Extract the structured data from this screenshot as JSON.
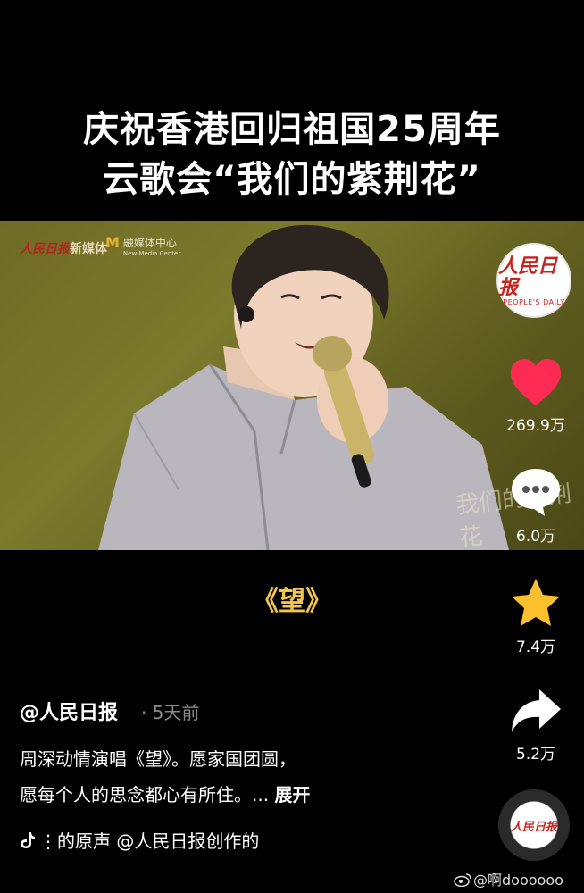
{
  "header": {
    "line1": "庆祝香港回归祖国25周年",
    "line2": "云歌会“我们的紫荆花”"
  },
  "video": {
    "watermark_left_red": "人民日报",
    "watermark_left_text": "新媒体",
    "watermark_right": "融媒体中心",
    "watermark_right_sub": "New Media Center",
    "calligraphy": "我们的紫荆花"
  },
  "song_title": "《望》",
  "sidebar": {
    "avatar_cn": "人民日报",
    "avatar_en": "PEOPLE'S DAILY",
    "likes": "269.9万",
    "comments": "6.0万",
    "favorites": "7.4万",
    "shares": "5.2万",
    "disc_label": "人民日报"
  },
  "post": {
    "author": "@人民日报",
    "time": "· 5天前",
    "desc_line1": "周深动情演唱《望》。愿家国团圆，",
    "desc_line2": "愿每个人的思念都心有所住。... ",
    "more": "展开",
    "music": "⋮的原声    @人民日报创作的"
  },
  "weibo_watermark": "@啊doooooo",
  "colors": {
    "like": "#fe2c55",
    "favorite": "#fbc02d",
    "song_title": "#f3c64b"
  }
}
